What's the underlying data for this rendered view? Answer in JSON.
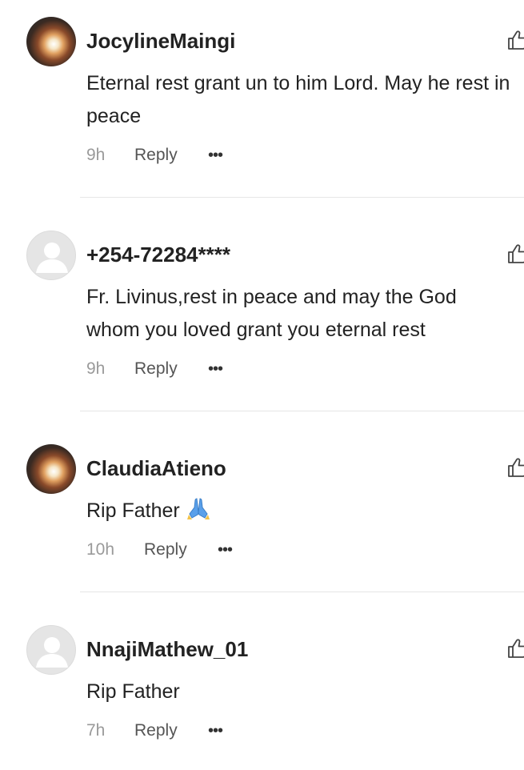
{
  "comments": [
    {
      "username": "JocylineMaingi",
      "avatar": "photo",
      "text": "Eternal rest grant un to him Lord. May he rest in peace",
      "time": "9h",
      "reply_label": "Reply",
      "more_label": "•••"
    },
    {
      "username": "+254-72284****",
      "avatar": "default",
      "text": "Fr. Livinus,rest in peace and may the God whom you loved grant you eternal rest",
      "time": "9h",
      "reply_label": "Reply",
      "more_label": "•••"
    },
    {
      "username": "ClaudiaAtieno",
      "avatar": "photo",
      "text": "Rip Father",
      "emoji": "praying-hands",
      "time": "10h",
      "reply_label": "Reply",
      "more_label": "•••"
    },
    {
      "username": "NnajiMathew_01",
      "avatar": "default",
      "text": "Rip Father",
      "time": "7h",
      "reply_label": "Reply",
      "more_label": "•••"
    }
  ],
  "icons": {
    "like": "thumbs-up-outline-icon",
    "more": "more-dots-icon"
  },
  "colors": {
    "text": "#222222",
    "meta": "#9a9a9a",
    "divider": "#e6e6e6",
    "emoji": "#4a90e2"
  }
}
